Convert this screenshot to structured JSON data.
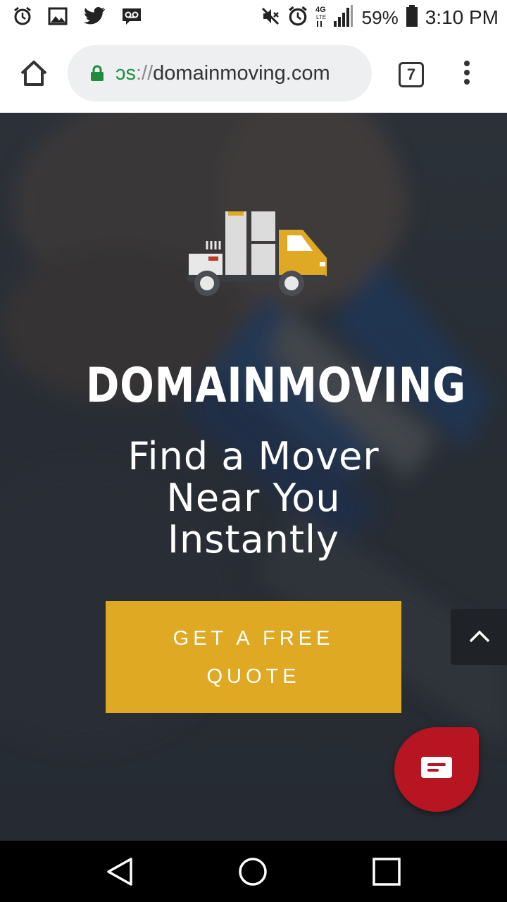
{
  "status_bar": {
    "battery_percent": "59%",
    "time": "3:10 PM",
    "network": "4G LTE",
    "icons": [
      "alarm-icon",
      "image-icon",
      "twitter-icon",
      "voicemail-icon",
      "mute-icon",
      "alarm-icon",
      "signal-icon",
      "battery-icon"
    ]
  },
  "browser": {
    "url_scheme": "ɔs",
    "url_sep": "://",
    "url_domain": "domainmoving.com",
    "tab_count": "7"
  },
  "hero": {
    "brand": "DOMAINMOVING",
    "tagline": [
      "Find a Mover",
      "Near You",
      "Instantly"
    ],
    "cta_lines": [
      "GET A FREE",
      "QUOTE"
    ]
  },
  "colors": {
    "accent": "#e0a923",
    "chat": "#b71522",
    "secure_lock": "#1e8e3e"
  }
}
